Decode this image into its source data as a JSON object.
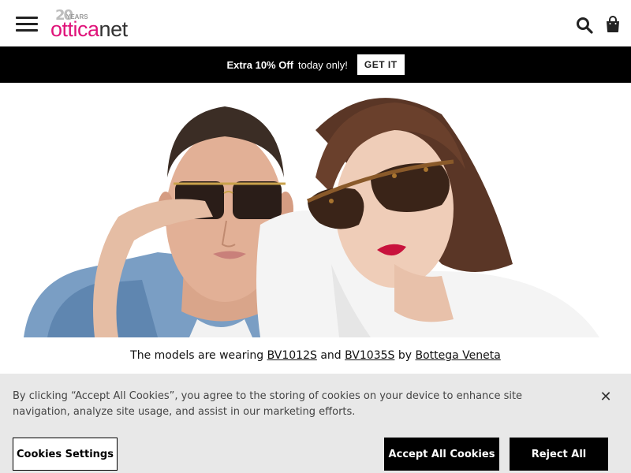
{
  "header": {
    "logo": {
      "badge": "20",
      "badge_sub": "YEARS",
      "ottica": "ottica",
      "net": "net"
    },
    "icons": {
      "menu": "hamburger-menu-icon",
      "search": "search-icon",
      "cart": "shopping-bag-icon"
    }
  },
  "promo": {
    "strong": "Extra 10% Off",
    "light": "today only!",
    "button": "GET IT"
  },
  "caption": {
    "prefix": "The models are wearing",
    "model1": "BV1012S",
    "and": "and",
    "model2": "BV1035S",
    "by": "by",
    "brand": "Bottega Veneta"
  },
  "cookie": {
    "text": "By clicking “Accept All Cookies”, you agree to the storing of cookies on your device to enhance site navigation, analyze site usage, and assist in our marketing efforts.",
    "settings": "Cookies Settings",
    "accept": "Accept All Cookies",
    "reject": "Reject All",
    "close": "✕"
  },
  "colors": {
    "brand_pink": "#e0137a",
    "promo_bg": "#000000",
    "banner_bg": "#e8e8e8"
  }
}
